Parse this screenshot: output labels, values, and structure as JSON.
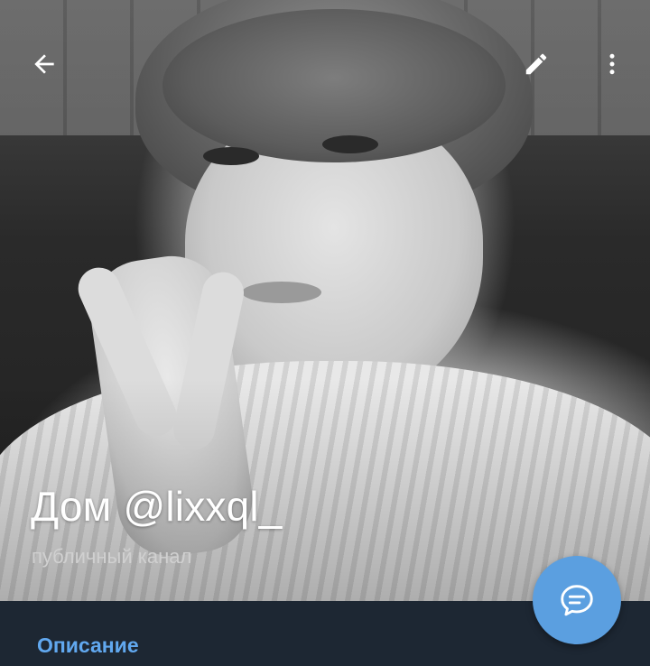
{
  "header": {
    "back_icon": "back-arrow-icon",
    "edit_icon": "pencil-icon",
    "menu_icon": "more-vertical-icon"
  },
  "profile": {
    "title": "Дом @lixxql_",
    "subtitle": "публичный канал",
    "photo": "channel-avatar-photo"
  },
  "fab": {
    "icon": "chat-bubble-icon",
    "color": "#5b9fe0"
  },
  "info": {
    "section_label": "Описание",
    "accent_color": "#61a8ef",
    "background": "#1d2733"
  }
}
